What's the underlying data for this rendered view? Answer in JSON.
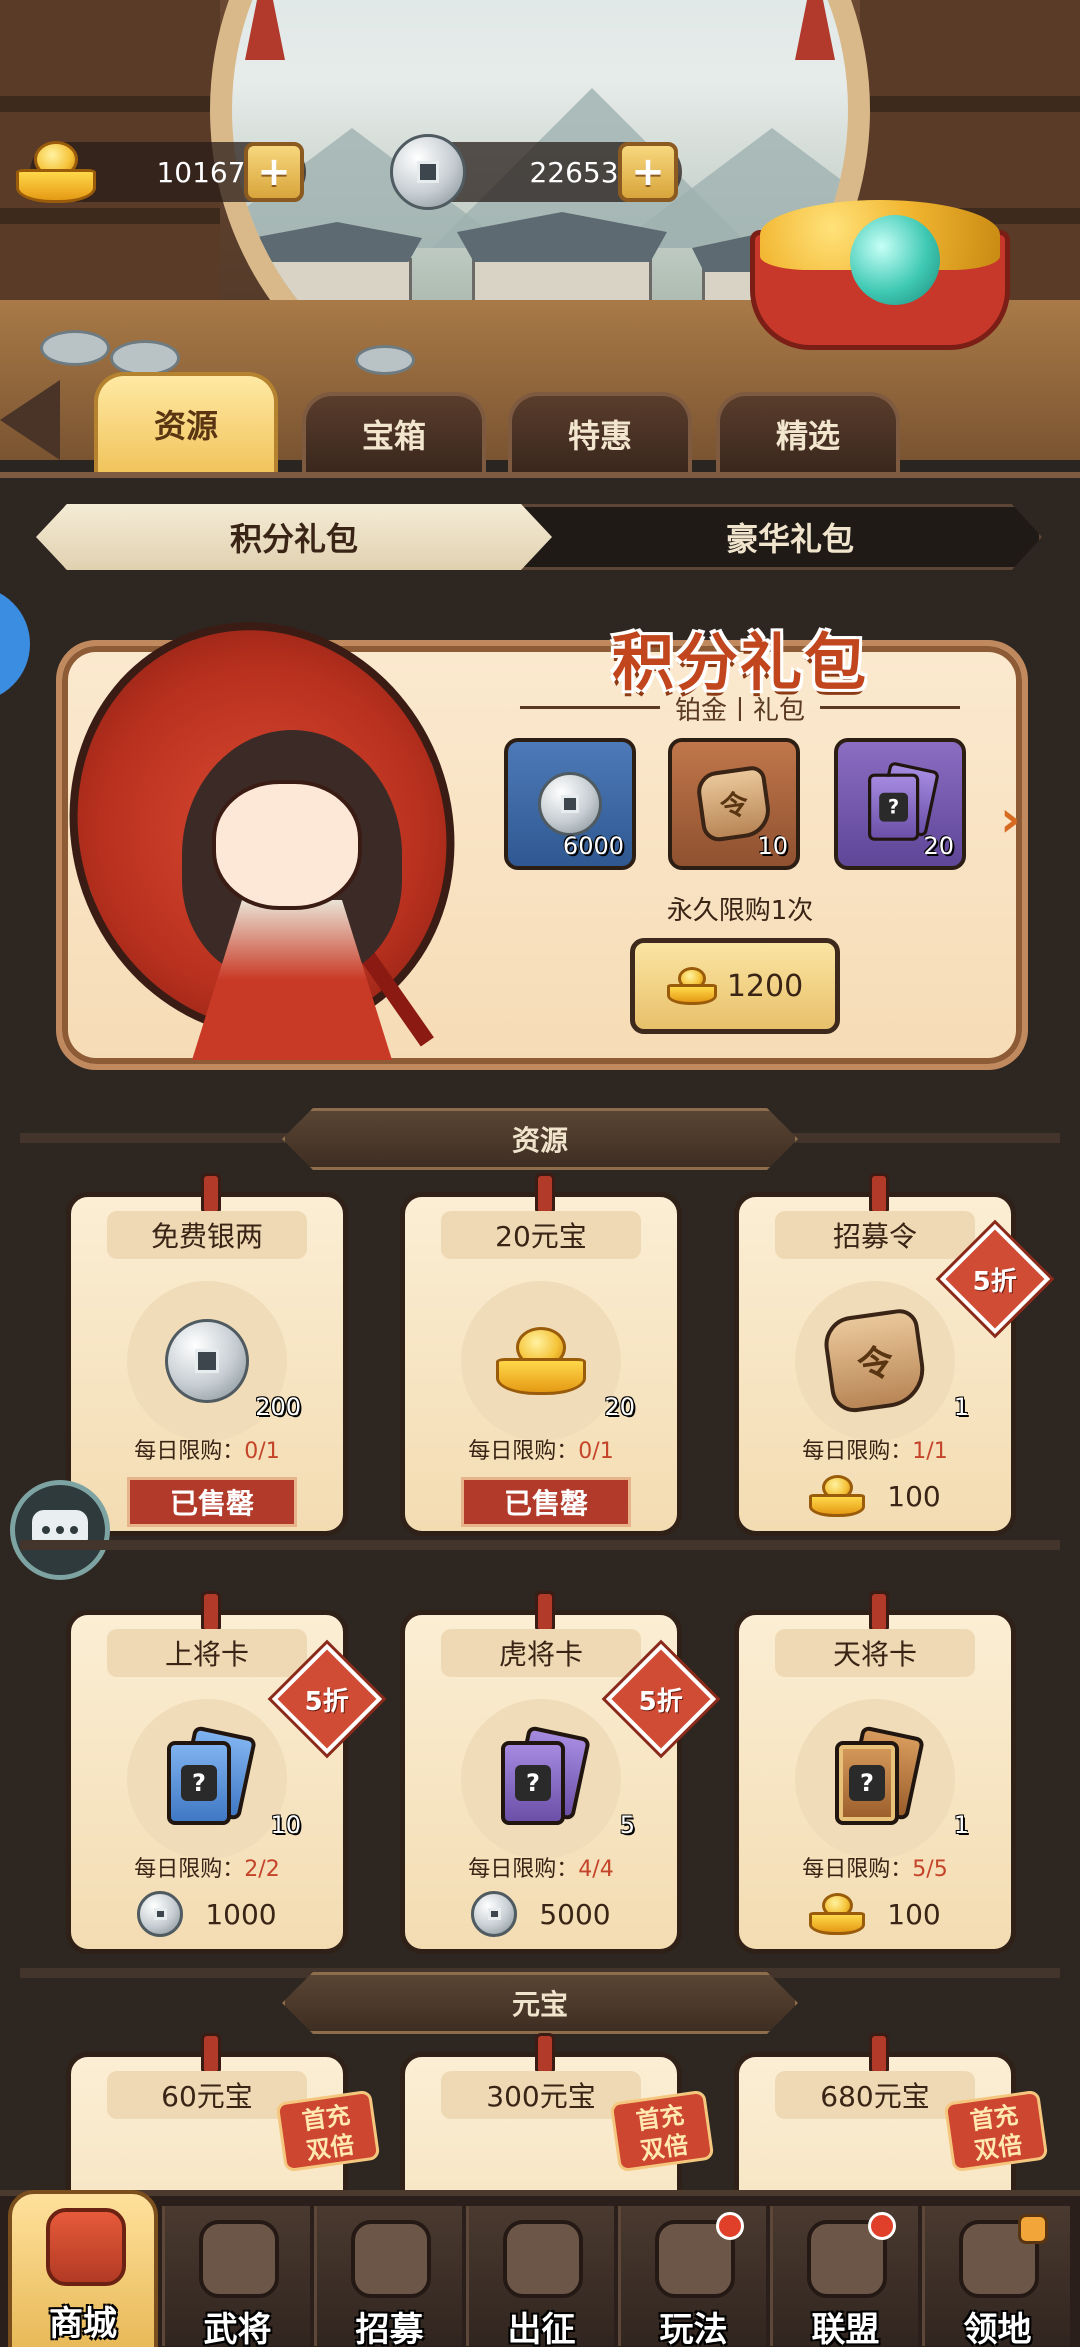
{
  "currency": {
    "gold": "10167",
    "silver": "22653"
  },
  "tabs": [
    {
      "label": "资源"
    },
    {
      "label": "宝箱"
    },
    {
      "label": "特惠"
    },
    {
      "label": "精选"
    }
  ],
  "subtabs": [
    {
      "label": "积分礼包"
    },
    {
      "label": "豪华礼包"
    }
  ],
  "banner": {
    "title": "积分礼包",
    "subtitle": "铂金丨礼包",
    "rewards": [
      {
        "icon": "silver-coin-icon",
        "qty": "6000"
      },
      {
        "icon": "recruit-token-icon",
        "qty": "10"
      },
      {
        "icon": "mystery-card-icon",
        "qty": "20"
      }
    ],
    "limit": "永久限购1次",
    "price": "1200"
  },
  "sections": {
    "resources": "资源",
    "yuanbao": "元宝"
  },
  "cards": [
    {
      "name": "免费银两",
      "qty": "200",
      "limit_label": "每日限购：",
      "limit_count": "0/1",
      "sold": "已售罄"
    },
    {
      "name": "20元宝",
      "qty": "20",
      "limit_label": "每日限购：",
      "limit_count": "0/1",
      "sold": "已售罄"
    },
    {
      "name": "招募令",
      "qty": "1",
      "limit_label": "每日限购：",
      "limit_count": "1/1",
      "price": "100",
      "discount": "5折",
      "token_glyph": "令"
    },
    {
      "name": "上将卡",
      "qty": "10",
      "limit_label": "每日限购：",
      "limit_count": "2/2",
      "price": "1000",
      "discount": "5折",
      "card_glyph": "?"
    },
    {
      "name": "虎将卡",
      "qty": "5",
      "limit_label": "每日限购：",
      "limit_count": "4/4",
      "price": "5000",
      "discount": "5折",
      "card_glyph": "?"
    },
    {
      "name": "天将卡",
      "qty": "1",
      "limit_label": "每日限购：",
      "limit_count": "5/5",
      "price": "100",
      "card_glyph": "?"
    },
    {
      "name": "60元宝",
      "badge_line1": "首充",
      "badge_line2": "双倍"
    },
    {
      "name": "300元宝",
      "badge_line1": "首充",
      "badge_line2": "双倍"
    },
    {
      "name": "680元宝",
      "badge_line1": "首充",
      "badge_line2": "双倍"
    }
  ],
  "nav": [
    {
      "label": "商城"
    },
    {
      "label": "武将"
    },
    {
      "label": "招募"
    },
    {
      "label": "出征"
    },
    {
      "label": "玩法"
    },
    {
      "label": "联盟"
    },
    {
      "label": "领地"
    }
  ],
  "colors": {
    "accent_gold": "#f1c45c",
    "discount_red": "#d14c35",
    "limit_red": "#c4442a"
  }
}
